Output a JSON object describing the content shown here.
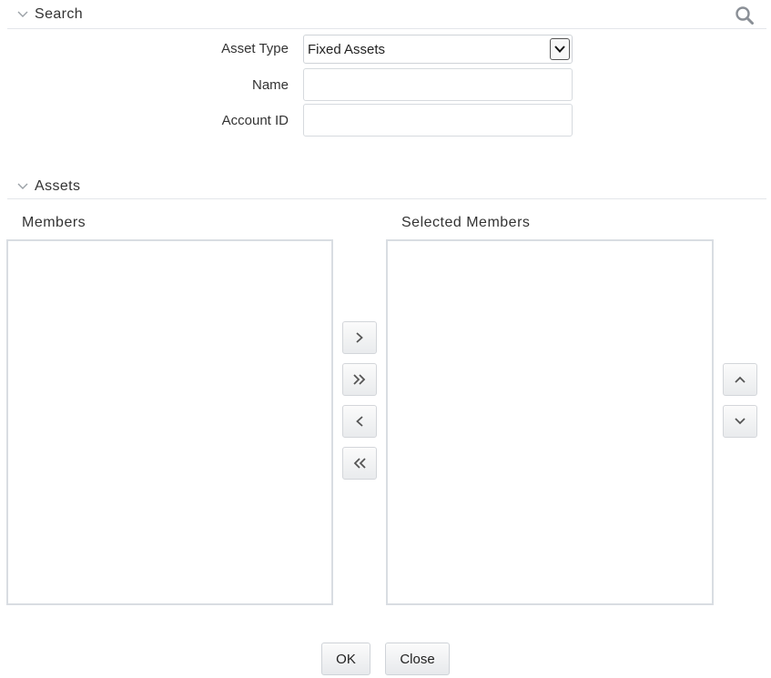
{
  "search": {
    "title": "Search",
    "asset_type_label": "Asset Type",
    "asset_type_value": "Fixed Assets",
    "name_label": "Name",
    "name_value": "",
    "account_id_label": "Account ID",
    "account_id_value": ""
  },
  "assets": {
    "title": "Assets",
    "members_label": "Members",
    "selected_members_label": "Selected Members",
    "members": [],
    "selected_members": []
  },
  "transfer_buttons": {
    "move_right": "›",
    "move_all_right": "»",
    "move_left": "‹",
    "move_all_left": "«"
  },
  "footer": {
    "ok_label": "OK",
    "close_label": "Close"
  },
  "colors": {
    "border": "#d9dde2",
    "text": "#333333",
    "icon": "#8a8f96"
  }
}
